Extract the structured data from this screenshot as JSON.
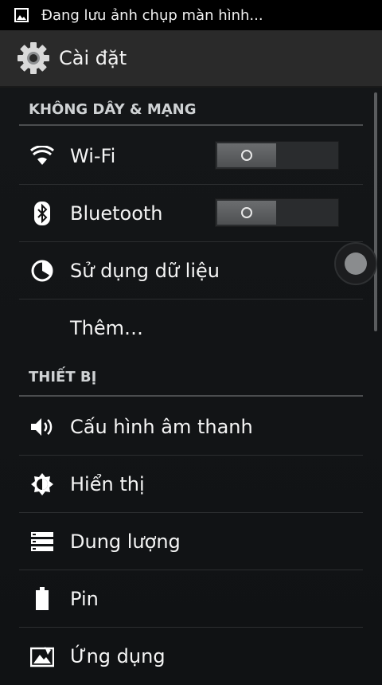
{
  "status_bar": {
    "notification_icon": "picture-icon",
    "text": "Đang lưu ảnh chụp màn hình..."
  },
  "action_bar": {
    "app_icon": "gear-icon",
    "title": "Cài đặt"
  },
  "sections": [
    {
      "header": "KHÔNG DÂY & MẠNG",
      "items": [
        {
          "label": "Wi-Fi",
          "icon": "wifi-icon",
          "switch": "O"
        },
        {
          "label": "Bluetooth",
          "icon": "bluetooth-icon",
          "switch": "O"
        },
        {
          "label": "Sử dụng dữ liệu",
          "icon": "data-usage-icon"
        },
        {
          "label": "Thêm…"
        }
      ]
    },
    {
      "header": "THIẾT BỊ",
      "items": [
        {
          "label": "Cấu hình âm thanh",
          "icon": "speaker-icon"
        },
        {
          "label": "Hiển thị",
          "icon": "brightness-icon"
        },
        {
          "label": "Dung lượng",
          "icon": "storage-icon"
        },
        {
          "label": "Pin",
          "icon": "battery-icon"
        },
        {
          "label": "Ứng dụng",
          "icon": "apps-icon"
        }
      ]
    }
  ],
  "colors": {
    "status_bar": "#000000",
    "action_bar": "#2a2a2a",
    "background": "#101214",
    "divider": "#4b4d4f"
  }
}
